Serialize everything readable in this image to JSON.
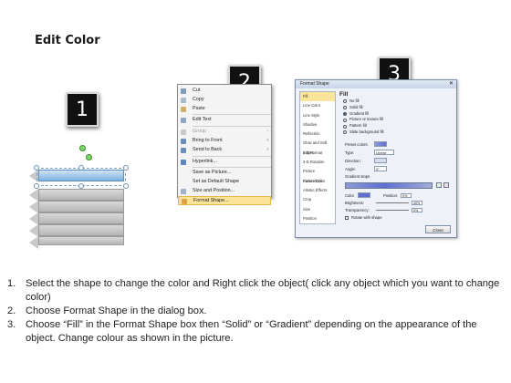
{
  "title": "Edit Color",
  "steps_badges": [
    "1",
    "2",
    "3"
  ],
  "context_menu": {
    "items": [
      {
        "label": "Cut",
        "icon": "scissors-icon",
        "arrow": ""
      },
      {
        "label": "Copy",
        "icon": "copy-icon",
        "arrow": ""
      },
      {
        "label": "Paste",
        "icon": "paste-icon",
        "arrow": ""
      },
      {
        "label": "Edit Text",
        "icon": "edit-text-icon",
        "arrow": ""
      },
      {
        "label": "Group",
        "icon": "group-icon",
        "arrow": "›"
      },
      {
        "label": "Bring to Front",
        "icon": "bring-front-icon",
        "arrow": "›"
      },
      {
        "label": "Send to Back",
        "icon": "send-back-icon",
        "arrow": "›"
      },
      {
        "label": "Hyperlink...",
        "icon": "hyperlink-icon",
        "arrow": ""
      },
      {
        "label": "Save as Picture...",
        "icon": "",
        "arrow": ""
      },
      {
        "label": "Set as Default Shape",
        "icon": "",
        "arrow": ""
      },
      {
        "label": "Size and Position...",
        "icon": "size-icon",
        "arrow": ""
      },
      {
        "label": "Format Shape...",
        "icon": "format-shape-icon",
        "arrow": ""
      }
    ]
  },
  "dialog": {
    "title": "Format Shape",
    "close_glyph": "✕",
    "categories": [
      "Fill",
      "Line Color",
      "Line Style",
      "Shadow",
      "Reflection",
      "Glow and Soft Edges",
      "3-D Format",
      "3-D Rotation",
      "Picture Corrections",
      "Picture Color",
      "Artistic Effects",
      "Crop",
      "Size",
      "Position",
      "Text Box",
      "Alt Text"
    ],
    "fill_heading": "Fill",
    "fill_options": [
      "No fill",
      "Solid fill",
      "Gradient fill",
      "Picture or texture fill",
      "Pattern fill",
      "Slide background fill"
    ],
    "selected_fill": "Gradient fill",
    "preset_label": "Preset colors:",
    "type_label": "Type:",
    "type_value": "Linear",
    "direction_label": "Direction:",
    "angle_label": "Angle:",
    "angle_value": "0°",
    "gradient_stops_label": "Gradient stops",
    "color_label": "Color",
    "position_label": "Position:",
    "position_value": "0%",
    "brightness_label": "Brightness:",
    "brightness_value": "40%",
    "transparency_label": "Transparency:",
    "transparency_value": "0%",
    "rotate_label": "Rotate with shape",
    "close_label": "Close"
  },
  "instructions": [
    {
      "num": "1.",
      "text": "Select the shape to change the color and Right click the object( click any object which you want to change color)"
    },
    {
      "num": "2.",
      "text": "Choose Format Shape in the dialog box."
    },
    {
      "num": "3.",
      "text": "Choose “Fill” in the Format Shape box then “Solid” or “Gradient” depending on the appearance of the object. Change colour as shown in the picture."
    }
  ],
  "colors": {
    "accent_blue": "#7fb1e0",
    "highlight": "#fbe39a",
    "badge": "#111111"
  }
}
